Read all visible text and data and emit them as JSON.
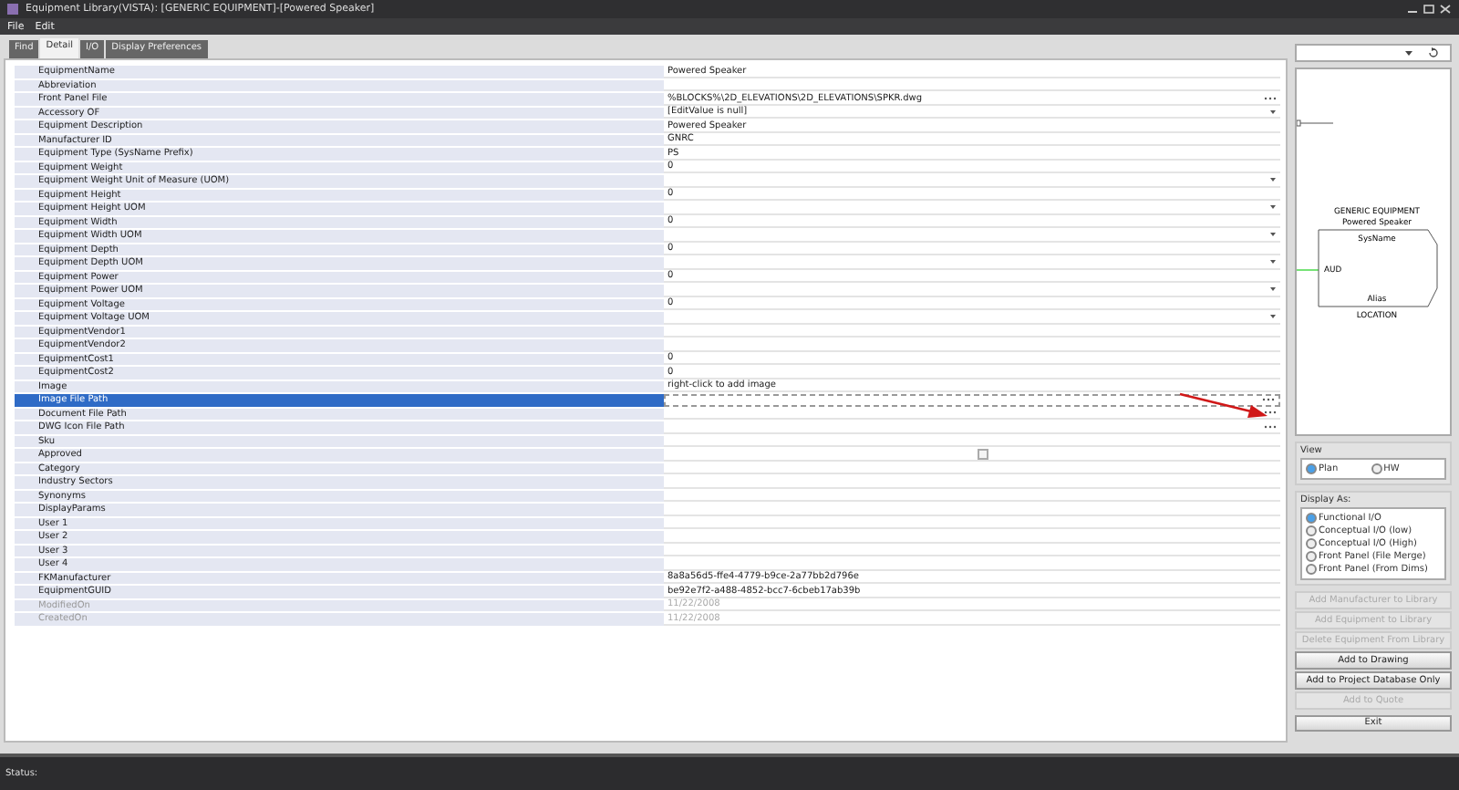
{
  "window": {
    "title": "Equipment Library(VISTA): [GENERIC EQUIPMENT]-[Powered Speaker]"
  },
  "menu": [
    "File",
    "Edit"
  ],
  "tabs": [
    {
      "label": "Find",
      "selected": false
    },
    {
      "label": "Detail",
      "selected": true
    },
    {
      "label": "I/O",
      "selected": false
    },
    {
      "label": "Display Preferences",
      "selected": false
    }
  ],
  "properties": [
    {
      "name": "EquipmentName",
      "value": "Powered Speaker",
      "kind": "text",
      "selected": false,
      "disabled": false
    },
    {
      "name": "Abbreviation",
      "kind": "text",
      "selected": false,
      "disabled": false
    },
    {
      "name": "Front Panel File",
      "value": "%BLOCKS%\\2D_ELEVATIONS\\2D_ELEVATIONS\\SPKR.dwg",
      "kind": "browse",
      "selected": false,
      "disabled": false
    },
    {
      "name": "Accessory OF",
      "value": "[EditValue is null]",
      "kind": "dropdown",
      "selected": false,
      "disabled": false
    },
    {
      "name": "Equipment Description",
      "value": "Powered Speaker",
      "kind": "text",
      "selected": false,
      "disabled": false
    },
    {
      "name": "Manufacturer ID",
      "value": "GNRC",
      "kind": "text",
      "selected": false,
      "disabled": false
    },
    {
      "name": "Equipment Type (SysName Prefix)",
      "value": "PS",
      "kind": "text",
      "selected": false,
      "disabled": false
    },
    {
      "name": "Equipment Weight",
      "value": "0",
      "kind": "text",
      "selected": false,
      "disabled": false
    },
    {
      "name": "Equipment Weight Unit of Measure (UOM)",
      "kind": "dropdown",
      "selected": false,
      "disabled": false
    },
    {
      "name": "Equipment Height",
      "value": "0",
      "kind": "text",
      "selected": false,
      "disabled": false
    },
    {
      "name": "Equipment Height UOM",
      "kind": "dropdown",
      "selected": false,
      "disabled": false
    },
    {
      "name": "Equipment Width",
      "value": "0",
      "kind": "text",
      "selected": false,
      "disabled": false
    },
    {
      "name": "Equipment Width UOM",
      "kind": "dropdown",
      "selected": false,
      "disabled": false
    },
    {
      "name": "Equipment Depth",
      "value": "0",
      "kind": "text",
      "selected": false,
      "disabled": false
    },
    {
      "name": "Equipment Depth UOM",
      "kind": "dropdown",
      "selected": false,
      "disabled": false
    },
    {
      "name": "Equipment Power",
      "value": "0",
      "kind": "text",
      "selected": false,
      "disabled": false
    },
    {
      "name": "Equipment Power UOM",
      "kind": "dropdown",
      "selected": false,
      "disabled": false
    },
    {
      "name": "Equipment Voltage",
      "value": "0",
      "kind": "text",
      "selected": false,
      "disabled": false
    },
    {
      "name": "Equipment Voltage UOM",
      "kind": "dropdown",
      "selected": false,
      "disabled": false
    },
    {
      "name": "EquipmentVendor1",
      "kind": "text",
      "selected": false,
      "disabled": false
    },
    {
      "name": "EquipmentVendor2",
      "kind": "text",
      "selected": false,
      "disabled": false
    },
    {
      "name": "EquipmentCost1",
      "value": "0",
      "kind": "text",
      "selected": false,
      "disabled": false
    },
    {
      "name": "EquipmentCost2",
      "value": "0",
      "kind": "text",
      "selected": false,
      "disabled": false
    },
    {
      "name": "Image",
      "value": "right-click to add image",
      "kind": "text",
      "selected": false,
      "disabled": false
    },
    {
      "name": "Image File Path",
      "kind": "browse",
      "selected": true,
      "disabled": false
    },
    {
      "name": "Document File Path",
      "kind": "browse",
      "selected": false,
      "disabled": false
    },
    {
      "name": "DWG Icon File Path",
      "kind": "browse",
      "selected": false,
      "disabled": false
    },
    {
      "name": "Sku",
      "kind": "text",
      "selected": false,
      "disabled": false
    },
    {
      "name": "Approved",
      "kind": "checkbox",
      "checked": false,
      "selected": false,
      "disabled": false
    },
    {
      "name": "Category",
      "kind": "text",
      "selected": false,
      "disabled": false
    },
    {
      "name": "Industry Sectors",
      "kind": "text",
      "selected": false,
      "disabled": false
    },
    {
      "name": "Synonyms",
      "kind": "text",
      "selected": false,
      "disabled": false
    },
    {
      "name": "DisplayParams",
      "kind": "text",
      "selected": false,
      "disabled": false
    },
    {
      "name": "User 1",
      "kind": "text",
      "selected": false,
      "disabled": false
    },
    {
      "name": "User 2",
      "kind": "text",
      "selected": false,
      "disabled": false
    },
    {
      "name": "User 3",
      "kind": "text",
      "selected": false,
      "disabled": false
    },
    {
      "name": "User 4",
      "kind": "text",
      "selected": false,
      "disabled": false
    },
    {
      "name": "FKManufacturer",
      "value": "8a8a56d5-ffe4-4779-b9ce-2a77bb2d796e",
      "kind": "text",
      "selected": false,
      "disabled": false
    },
    {
      "name": "EquipmentGUID",
      "value": "be92e7f2-a488-4852-bcc7-6cbeb17ab39b",
      "kind": "text",
      "selected": false,
      "disabled": false
    },
    {
      "name": "ModifiedOn",
      "value": "11/22/2008",
      "kind": "text",
      "selected": false,
      "disabled": true
    },
    {
      "name": "CreatedOn",
      "value": "11/22/2008",
      "kind": "text",
      "selected": false,
      "disabled": true
    }
  ],
  "preview": {
    "header": "GENERIC EQUIPMENT",
    "subheader": "Powered Speaker",
    "sysname": "SysName",
    "port": "AUD",
    "alias": "Alias",
    "location": "LOCATION"
  },
  "view": {
    "title": "View",
    "options": [
      {
        "label": "Plan",
        "selected": true
      },
      {
        "label": "HW",
        "selected": false
      }
    ]
  },
  "display_as": {
    "title": "Display As:",
    "options": [
      {
        "label": "Functional I/O",
        "selected": true
      },
      {
        "label": "Conceptual I/O (low)",
        "selected": false
      },
      {
        "label": "Conceptual I/O (High)",
        "selected": false
      },
      {
        "label": "Front Panel (File Merge)",
        "selected": false
      },
      {
        "label": "Front Panel (From Dims)",
        "selected": false
      }
    ]
  },
  "actions": [
    {
      "label": "Add Manufacturer to Library",
      "disabled": true
    },
    {
      "label": "Add Equipment to Library",
      "disabled": true
    },
    {
      "label": "Delete Equipment From Library",
      "disabled": true
    },
    {
      "label": "Add to Drawing",
      "disabled": false
    },
    {
      "label": "Add to Project Database Only",
      "disabled": false
    },
    {
      "label": "Add to Quote",
      "disabled": true
    }
  ],
  "exit": {
    "label": "Exit"
  },
  "status_bar": {
    "label": "Status:"
  }
}
